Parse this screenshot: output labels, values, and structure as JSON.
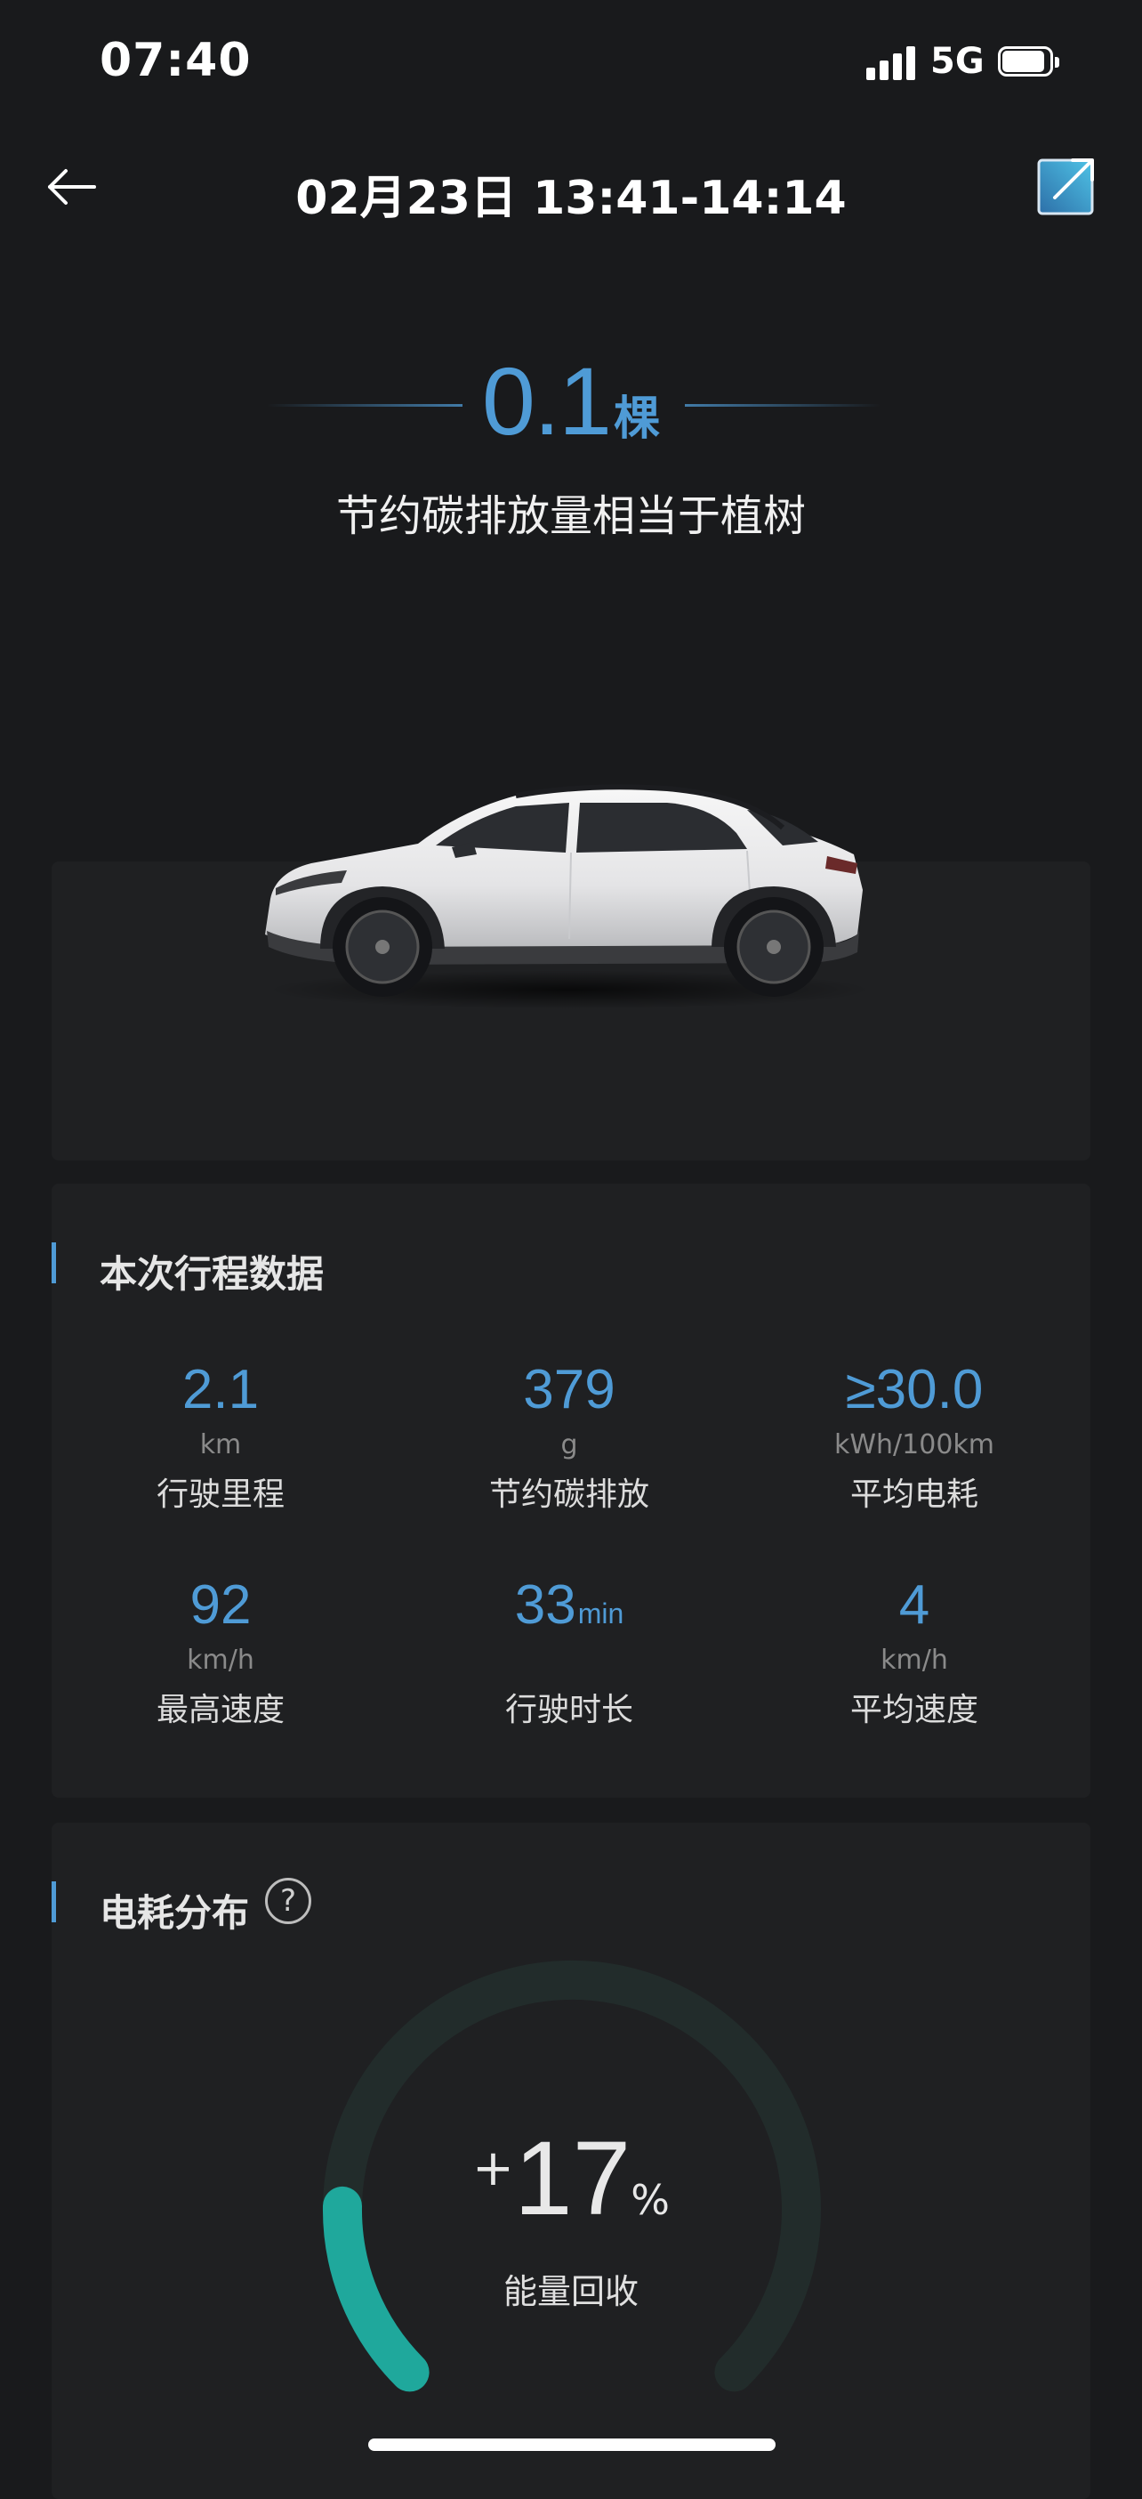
{
  "status_bar": {
    "time": "07:40",
    "network": "5G",
    "signal_bars": 4,
    "battery_level": 0.9
  },
  "header": {
    "title": "02月23日 13:41-14:14",
    "back_icon": "arrow-left-icon",
    "share_icon": "share-export-icon"
  },
  "hero": {
    "value": "0.1",
    "unit": "棵",
    "caption": "节约碳排放量相当于植树"
  },
  "trip": {
    "title": "本次行程数据",
    "stats": [
      {
        "value": "2.1",
        "unit": "km",
        "label": "行驶里程"
      },
      {
        "value": "379",
        "unit": "g",
        "label": "节约碳排放"
      },
      {
        "value": "≥30.0",
        "unit": "kWh/100km",
        "label": "平均电耗"
      },
      {
        "value": "92",
        "unit": "km/h",
        "label": "最高速度"
      },
      {
        "value": "33",
        "inline_unit": "min",
        "label": "行驶时长"
      },
      {
        "value": "4",
        "unit": "km/h",
        "label": "平均速度"
      }
    ]
  },
  "energy": {
    "title": "电耗分布",
    "help_icon": "question-circle-icon",
    "gauge": {
      "sign": "+",
      "percent": "17",
      "unit": "%",
      "label": "能量回收",
      "fraction": 0.17
    }
  },
  "colors": {
    "accent": "#4f9bd6",
    "gauge_fill": "#1fa89c",
    "gauge_track": "#222c2b",
    "background": "#191a1c",
    "card": "#1f2022"
  }
}
